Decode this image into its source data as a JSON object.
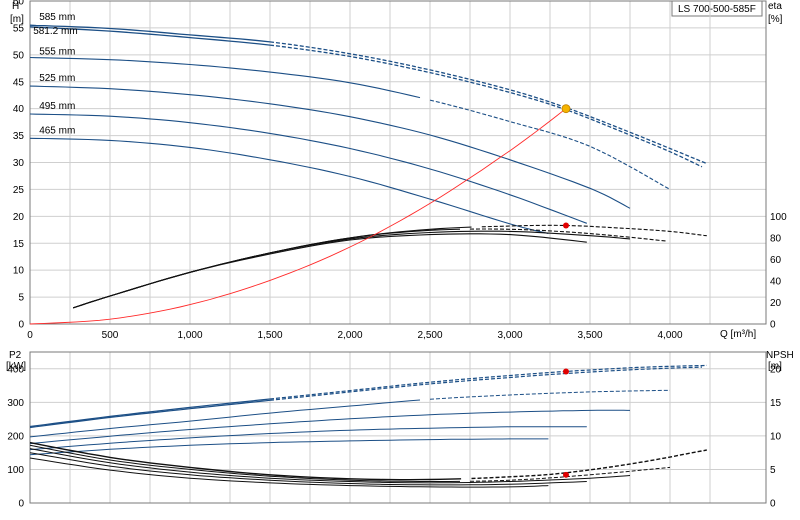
{
  "title_box": "LS 700-500-585F",
  "chart_data": [
    {
      "type": "line",
      "name_top": "head",
      "title": "LS 700-500-585F",
      "xlabel": "Q [m³/h]",
      "ylabel_left": [
        "H",
        "[m]"
      ],
      "ylabel_right": [
        "eta",
        "[%]"
      ],
      "x_ticks": [
        {
          "v": 0,
          "label": "0"
        },
        {
          "v": 500,
          "label": "500"
        },
        {
          "v": 1000,
          "label": "1,000"
        },
        {
          "v": 1500,
          "label": "1,500"
        },
        {
          "v": 2000,
          "label": "2,000"
        },
        {
          "v": 2500,
          "label": "2,500"
        },
        {
          "v": 3000,
          "label": "3,000"
        },
        {
          "v": 3500,
          "label": "3,500"
        },
        {
          "v": 4000,
          "label": "4,000"
        }
      ],
      "xlim": [
        0,
        4600
      ],
      "ylim_left": [
        0,
        60
      ],
      "y_ticks_left": [
        0,
        5,
        10,
        15,
        20,
        25,
        30,
        35,
        40,
        45,
        50,
        55,
        60
      ],
      "y_ticks_right": [
        {
          "v": 0,
          "label": "0"
        },
        {
          "v": 20,
          "label": "20"
        },
        {
          "v": 40,
          "label": "40"
        },
        {
          "v": 60,
          "label": "60"
        },
        {
          "v": 80,
          "label": "80"
        },
        {
          "v": 100,
          "label": "100"
        }
      ],
      "eta_scale": {
        "eta_per_H": 5,
        "note": "eta 0..100 spans H 0..20"
      },
      "head_curves": [
        {
          "label": "585 mm",
          "points": [
            [
              0,
              55.5
            ],
            [
              500,
              54.9
            ],
            [
              1000,
              53.7
            ],
            [
              1500,
              52.4
            ],
            [
              2000,
              50.2
            ],
            [
              2500,
              47.2
            ],
            [
              3000,
              43.5
            ],
            [
              3350,
              40.2
            ],
            [
              3700,
              36.2
            ],
            [
              4000,
              32.6
            ],
            [
              4230,
              29.8
            ]
          ],
          "solid_to": 1500
        },
        {
          "label": "581.2 mm",
          "points": [
            [
              0,
              55.2
            ],
            [
              500,
              54.4
            ],
            [
              1000,
              53.2
            ],
            [
              1500,
              51.8
            ],
            [
              2000,
              49.7
            ],
            [
              2500,
              46.7
            ],
            [
              3000,
              43.0
            ],
            [
              3350,
              39.8
            ],
            [
              3700,
              35.7
            ],
            [
              4000,
              32.0
            ],
            [
              4200,
              29.2
            ]
          ],
          "solid_to": 1500
        },
        {
          "label": "555 mm",
          "points": [
            [
              0,
              49.5
            ],
            [
              500,
              49.1
            ],
            [
              1000,
              48.2
            ],
            [
              1500,
              46.8
            ],
            [
              2000,
              44.8
            ],
            [
              2500,
              41.6
            ],
            [
              3000,
              37.6
            ],
            [
              3500,
              33.0
            ],
            [
              4000,
              25.0
            ]
          ],
          "solid_to": 2450
        },
        {
          "label": "525 mm",
          "points": [
            [
              0,
              44.2
            ],
            [
              500,
              43.7
            ],
            [
              1000,
              42.6
            ],
            [
              1500,
              40.9
            ],
            [
              2000,
              38.5
            ],
            [
              2500,
              35.1
            ],
            [
              3000,
              30.5
            ],
            [
              3500,
              25.2
            ],
            [
              3750,
              21.5
            ]
          ],
          "solid_to": 3750
        },
        {
          "label": "495 mm",
          "points": [
            [
              0,
              39.0
            ],
            [
              500,
              38.6
            ],
            [
              1000,
              37.4
            ],
            [
              1500,
              35.4
            ],
            [
              2000,
              32.6
            ],
            [
              2500,
              28.8
            ],
            [
              3000,
              24.0
            ],
            [
              3480,
              18.7
            ]
          ],
          "solid_to": 3480
        },
        {
          "label": "465 mm",
          "points": [
            [
              0,
              34.5
            ],
            [
              500,
              34.1
            ],
            [
              1000,
              32.8
            ],
            [
              1500,
              30.5
            ],
            [
              2000,
              27.4
            ],
            [
              2500,
              23.2
            ],
            [
              3000,
              18.6
            ],
            [
              3240,
              16.8
            ]
          ],
          "solid_to": 3240
        }
      ],
      "efficiency_curves": [
        {
          "points": [
            [
              270,
              15
            ],
            [
              500,
              26
            ],
            [
              1000,
              48
            ],
            [
              1500,
              66
            ],
            [
              2000,
              80
            ],
            [
              2500,
              88
            ],
            [
              3000,
              91
            ],
            [
              3350,
              91.5
            ],
            [
              3700,
              89
            ],
            [
              4000,
              86
            ],
            [
              4230,
              82
            ]
          ],
          "solid_to": 2800
        },
        {
          "points": [
            [
              270,
              15
            ],
            [
              500,
              26
            ],
            [
              1000,
              48
            ],
            [
              1500,
              66
            ],
            [
              2000,
              80
            ],
            [
              2500,
              87
            ],
            [
              3000,
              88
            ],
            [
              3500,
              84
            ],
            [
              3980,
              77
            ]
          ],
          "solid_to": 2700
        },
        {
          "points": [
            [
              270,
              15
            ],
            [
              500,
              26
            ],
            [
              1000,
              48
            ],
            [
              1500,
              66
            ],
            [
              2000,
              79
            ],
            [
              2500,
              85
            ],
            [
              3000,
              86
            ],
            [
              3500,
              82
            ],
            [
              3750,
              79
            ]
          ],
          "solid_to": 3750
        },
        {
          "points": [
            [
              270,
              15
            ],
            [
              500,
              26
            ],
            [
              1000,
              48
            ],
            [
              1500,
              65
            ],
            [
              2000,
              78
            ],
            [
              2500,
              83
            ],
            [
              3000,
              83
            ],
            [
              3480,
              76
            ]
          ],
          "solid_to": 3480
        }
      ],
      "system_curve": {
        "points": [
          [
            0,
            0
          ],
          [
            500,
            0.9
          ],
          [
            1000,
            3.6
          ],
          [
            1500,
            8.1
          ],
          [
            2000,
            14.3
          ],
          [
            2500,
            22.4
          ],
          [
            3000,
            32.2
          ],
          [
            3350,
            40.0
          ]
        ]
      },
      "duty_point": {
        "q": 3350,
        "h": 40.0,
        "color": "#f5b400"
      },
      "eta_point": {
        "q": 3350,
        "eta": 91.5,
        "color": "#e00000"
      }
    },
    {
      "type": "line",
      "name_top": "power",
      "ylabel_left": [
        "P2",
        "[kW]"
      ],
      "ylabel_right": [
        "NPSH",
        "[m]"
      ],
      "ylim_left": [
        0,
        450
      ],
      "y_ticks_left": [
        0,
        100,
        200,
        300,
        400
      ],
      "ylim_right": [
        0,
        22.5
      ],
      "y_ticks_right": [
        0,
        5,
        10,
        15,
        20
      ],
      "power_curves": [
        {
          "points": [
            [
              0,
              228
            ],
            [
              500,
              258
            ],
            [
              1000,
              285
            ],
            [
              1500,
              310
            ],
            [
              2000,
              335
            ],
            [
              2500,
              360
            ],
            [
              3000,
              380
            ],
            [
              3350,
              392
            ],
            [
              3800,
              404
            ],
            [
              4230,
              410
            ]
          ],
          "solid_to": 1500
        },
        {
          "points": [
            [
              0,
              225
            ],
            [
              500,
              255
            ],
            [
              1000,
              281
            ],
            [
              1500,
              306
            ],
            [
              2000,
              331
            ],
            [
              2500,
              355
            ],
            [
              3000,
              374
            ],
            [
              3350,
              386
            ],
            [
              3800,
              398
            ],
            [
              4200,
              405
            ]
          ],
          "solid_to": 1500
        },
        {
          "points": [
            [
              0,
              197
            ],
            [
              500,
              222
            ],
            [
              1000,
              244
            ],
            [
              1500,
              268
            ],
            [
              2000,
              289
            ],
            [
              2500,
              309
            ],
            [
              3000,
              322
            ],
            [
              3500,
              331
            ],
            [
              4000,
              336
            ]
          ],
          "solid_to": 2450
        },
        {
          "points": [
            [
              0,
              177
            ],
            [
              500,
              199
            ],
            [
              1000,
              219
            ],
            [
              1500,
              236
            ],
            [
              2000,
              251
            ],
            [
              2500,
              263
            ],
            [
              3000,
              271
            ],
            [
              3500,
              276
            ],
            [
              3750,
              276
            ]
          ],
          "solid_to": 3750
        },
        {
          "points": [
            [
              0,
              159
            ],
            [
              500,
              178
            ],
            [
              1000,
              194
            ],
            [
              1500,
              207
            ],
            [
              2000,
              217
            ],
            [
              2500,
              223
            ],
            [
              3000,
              227
            ],
            [
              3480,
              227
            ]
          ],
          "solid_to": 3480
        },
        {
          "points": [
            [
              0,
              144
            ],
            [
              500,
              160
            ],
            [
              1000,
              172
            ],
            [
              1500,
              180
            ],
            [
              2000,
              185
            ],
            [
              2500,
              189
            ],
            [
              3000,
              191
            ],
            [
              3240,
              191
            ]
          ],
          "solid_to": 3240
        }
      ],
      "npsh_curves": [
        {
          "points": [
            [
              0,
              9.0
            ],
            [
              500,
              6.8
            ],
            [
              1000,
              5.3
            ],
            [
              1500,
              4.2
            ],
            [
              2000,
              3.6
            ],
            [
              2500,
              3.5
            ],
            [
              3000,
              3.9
            ],
            [
              3350,
              4.5
            ],
            [
              3800,
              6.0
            ],
            [
              4230,
              7.9
            ]
          ],
          "solid_to": 2700
        },
        {
          "points": [
            [
              0,
              8.6
            ],
            [
              500,
              6.4
            ],
            [
              1000,
              5.0
            ],
            [
              1500,
              4.0
            ],
            [
              2000,
              3.4
            ],
            [
              2500,
              3.2
            ],
            [
              3000,
              3.4
            ],
            [
              3500,
              4.2
            ],
            [
              4000,
              5.3
            ]
          ],
          "solid_to": 2700
        },
        {
          "points": [
            [
              0,
              8.1
            ],
            [
              500,
              6.0
            ],
            [
              1000,
              4.6
            ],
            [
              1500,
              3.7
            ],
            [
              2000,
              3.2
            ],
            [
              2500,
              3.0
            ],
            [
              3000,
              3.2
            ],
            [
              3500,
              3.7
            ],
            [
              3750,
              4.1
            ]
          ],
          "solid_to": 3750
        },
        {
          "points": [
            [
              0,
              7.5
            ],
            [
              500,
              5.5
            ],
            [
              1000,
              4.2
            ],
            [
              1500,
              3.4
            ],
            [
              2000,
              2.9
            ],
            [
              2500,
              2.7
            ],
            [
              3000,
              2.8
            ],
            [
              3480,
              3.2
            ]
          ],
          "solid_to": 3480
        },
        {
          "points": [
            [
              0,
              6.7
            ],
            [
              500,
              4.9
            ],
            [
              1000,
              3.7
            ],
            [
              1500,
              3.0
            ],
            [
              2000,
              2.6
            ],
            [
              2500,
              2.4
            ],
            [
              3000,
              2.4
            ],
            [
              3240,
              2.6
            ]
          ],
          "solid_to": 3240
        }
      ],
      "power_point": {
        "q": 3350,
        "p": 392,
        "color": "#e00000"
      },
      "npsh_point": {
        "q": 3350,
        "npsh": 4.2,
        "color": "#e00000"
      }
    }
  ],
  "colors": {
    "head": "#1c4f86",
    "eff": "#111111",
    "system": "#ff2a2a",
    "grid": "#cfcfcf",
    "frame": "#7a7a7a"
  }
}
